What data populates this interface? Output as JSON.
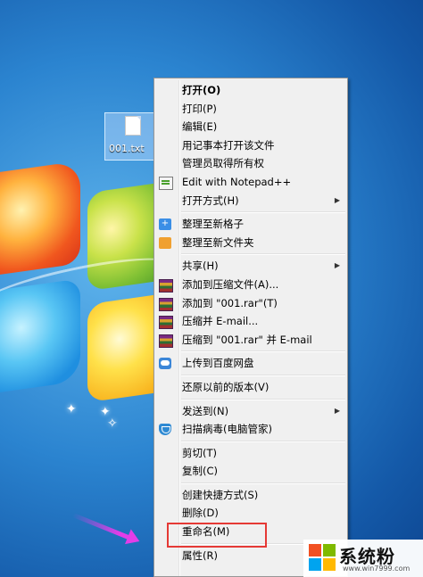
{
  "desktop": {
    "file_name": "001.txt"
  },
  "context_menu": {
    "items": [
      {
        "label": "打开(O)",
        "bold": true
      },
      {
        "label": "打印(P)"
      },
      {
        "label": "编辑(E)"
      },
      {
        "label": "用记事本打开该文件"
      },
      {
        "label": "管理员取得所有权"
      },
      {
        "label": "Edit with Notepad++",
        "icon": "notepad-plus-icon"
      },
      {
        "label": "打开方式(H)",
        "submenu": true
      },
      {
        "label": "整理至新格子",
        "icon": "fences-blue-icon"
      },
      {
        "label": "整理至新文件夹",
        "icon": "fences-folder-icon"
      },
      {
        "label": "共享(H)",
        "submenu": true
      },
      {
        "label": "添加到压缩文件(A)...",
        "icon": "winrar-icon"
      },
      {
        "label": "添加到 \"001.rar\"(T)",
        "icon": "winrar-icon"
      },
      {
        "label": "压缩并 E-mail...",
        "icon": "winrar-icon"
      },
      {
        "label": "压缩到 \"001.rar\" 并 E-mail",
        "icon": "winrar-icon"
      },
      {
        "label": "上传到百度网盘",
        "icon": "baidu-cloud-icon"
      },
      {
        "label": "还原以前的版本(V)"
      },
      {
        "label": "发送到(N)",
        "submenu": true
      },
      {
        "label": "扫描病毒(电脑管家)",
        "icon": "shield-icon"
      },
      {
        "label": "剪切(T)"
      },
      {
        "label": "复制(C)"
      },
      {
        "label": "创建快捷方式(S)"
      },
      {
        "label": "删除(D)"
      },
      {
        "label": "重命名(M)"
      },
      {
        "label": "属性(R)"
      }
    ],
    "submenu_arrow": "▶"
  },
  "watermark": {
    "text": "系统粉",
    "url": "www.win7999.com"
  },
  "colors": {
    "highlight_box": "#e53935",
    "pointer_arrow": "#e33de8",
    "menu_background": "#f0f0f0"
  }
}
